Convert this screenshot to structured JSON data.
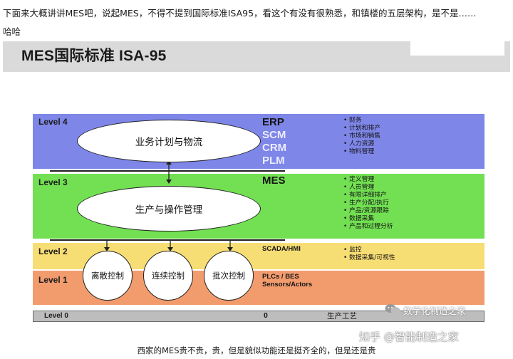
{
  "intro": {
    "line1": "下面来大概讲讲MES吧，说起MES，不得不提到国际标准ISA95，看这个有没有很熟悉，和镇楼的五层架构，是不是……",
    "line2": "哈哈"
  },
  "slide": {
    "title": "MES国际标准 ISA-95",
    "levels": [
      {
        "label": "Level 4",
        "ellipse": "业务计划与物流",
        "systems": [
          "ERP",
          "SCM",
          "CRM",
          "PLM"
        ],
        "items": [
          "财务",
          "计划和排产",
          "市场和销售",
          "人力资源",
          "物料管理"
        ]
      },
      {
        "label": "Level 3",
        "ellipse": "生产与操作管理",
        "systems": [
          "MES"
        ],
        "items": [
          "定义管理",
          "人员管理",
          "有限详细排产",
          "生产分配/执行",
          "产品/资源跟踪",
          "数据采集",
          "产品和过程分析"
        ]
      },
      {
        "label": "Level 2",
        "systems": [
          "SCADA/HMI"
        ],
        "items": [
          "监控",
          "数据采集/可视性"
        ]
      },
      {
        "label": "Level 1",
        "systems": [
          "PLCs / BES",
          "Sensors/Actors"
        ]
      },
      {
        "label": "Level 0",
        "system": "0",
        "item": "生产工艺"
      }
    ],
    "circles": [
      "离散控制",
      "连续控制",
      "批次控制"
    ],
    "wechat_watermark": "数字化制造之家"
  },
  "zhihu_watermark": "知乎 @智能制造之家",
  "caption": "西家的MES贵不贵，贵，但是貌似功能还是挺齐全的，但是还是贵",
  "colors": {
    "level4": "#7e86e8",
    "level3": "#72e052",
    "level2": "#f7de74",
    "level1": "#f29c6e",
    "level0": "#bdbdbd",
    "header": "#dadada"
  }
}
